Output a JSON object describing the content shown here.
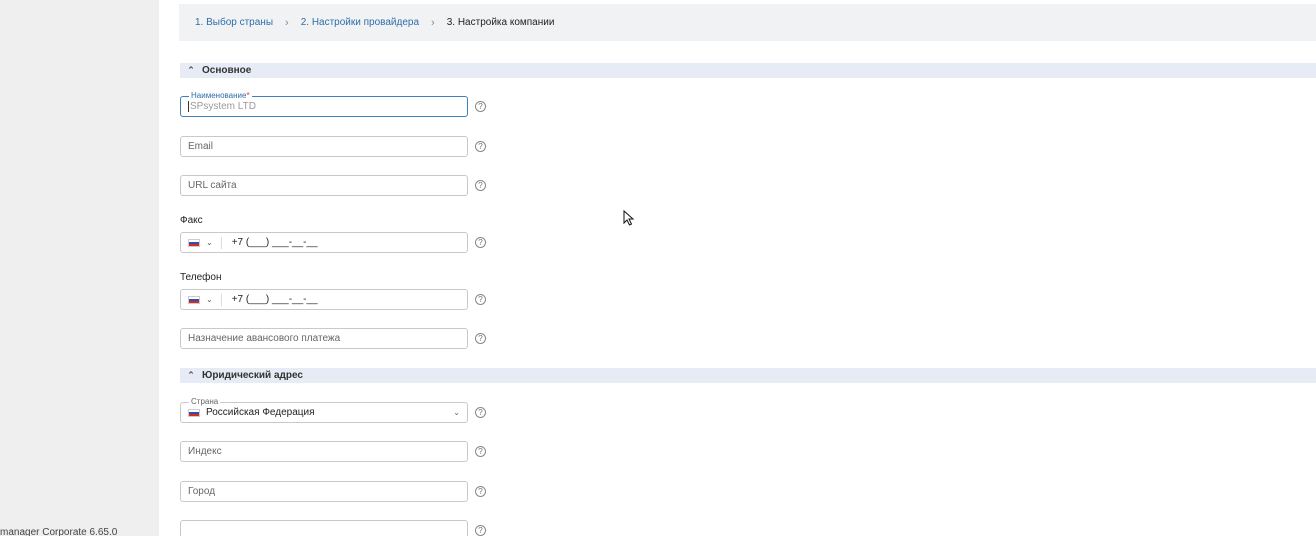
{
  "footer": {
    "version_text": "manager Corporate 6.65.0"
  },
  "breadcrumb": {
    "step1": "1. Выбор страны",
    "step2": "2. Настройки провайдера",
    "step3": "3. Настройка компании"
  },
  "sections": {
    "basic": "Основное",
    "legal_address": "Юридический адрес"
  },
  "form": {
    "name": {
      "label": "Наименование",
      "required_mark": "*",
      "placeholder": "SPsystem LTD"
    },
    "email": {
      "placeholder": "Email"
    },
    "site_url": {
      "placeholder": "URL сайта"
    },
    "fax": {
      "label": "Факс",
      "value": "+7 (___) ___-__-__"
    },
    "phone": {
      "label": "Телефон",
      "value": "+7 (___) ___-__-__"
    },
    "advance_payment": {
      "placeholder": "Назначение авансового платежа"
    },
    "country": {
      "label": "Страна",
      "value": "Российская Федерация"
    },
    "postcode": {
      "placeholder": "Индекс"
    },
    "city": {
      "placeholder": "Город"
    },
    "help_glyph": "?"
  },
  "icons": {
    "chevron_up": "⌃",
    "chevron_right": "›",
    "chevron_down": "⌄",
    "flag": "ru-flag-icon"
  },
  "colors": {
    "accent": "#2f6ea8",
    "section_bg": "#e6ebf5",
    "breadcrumb_bg": "#f1f2f4",
    "required": "#d33333"
  }
}
